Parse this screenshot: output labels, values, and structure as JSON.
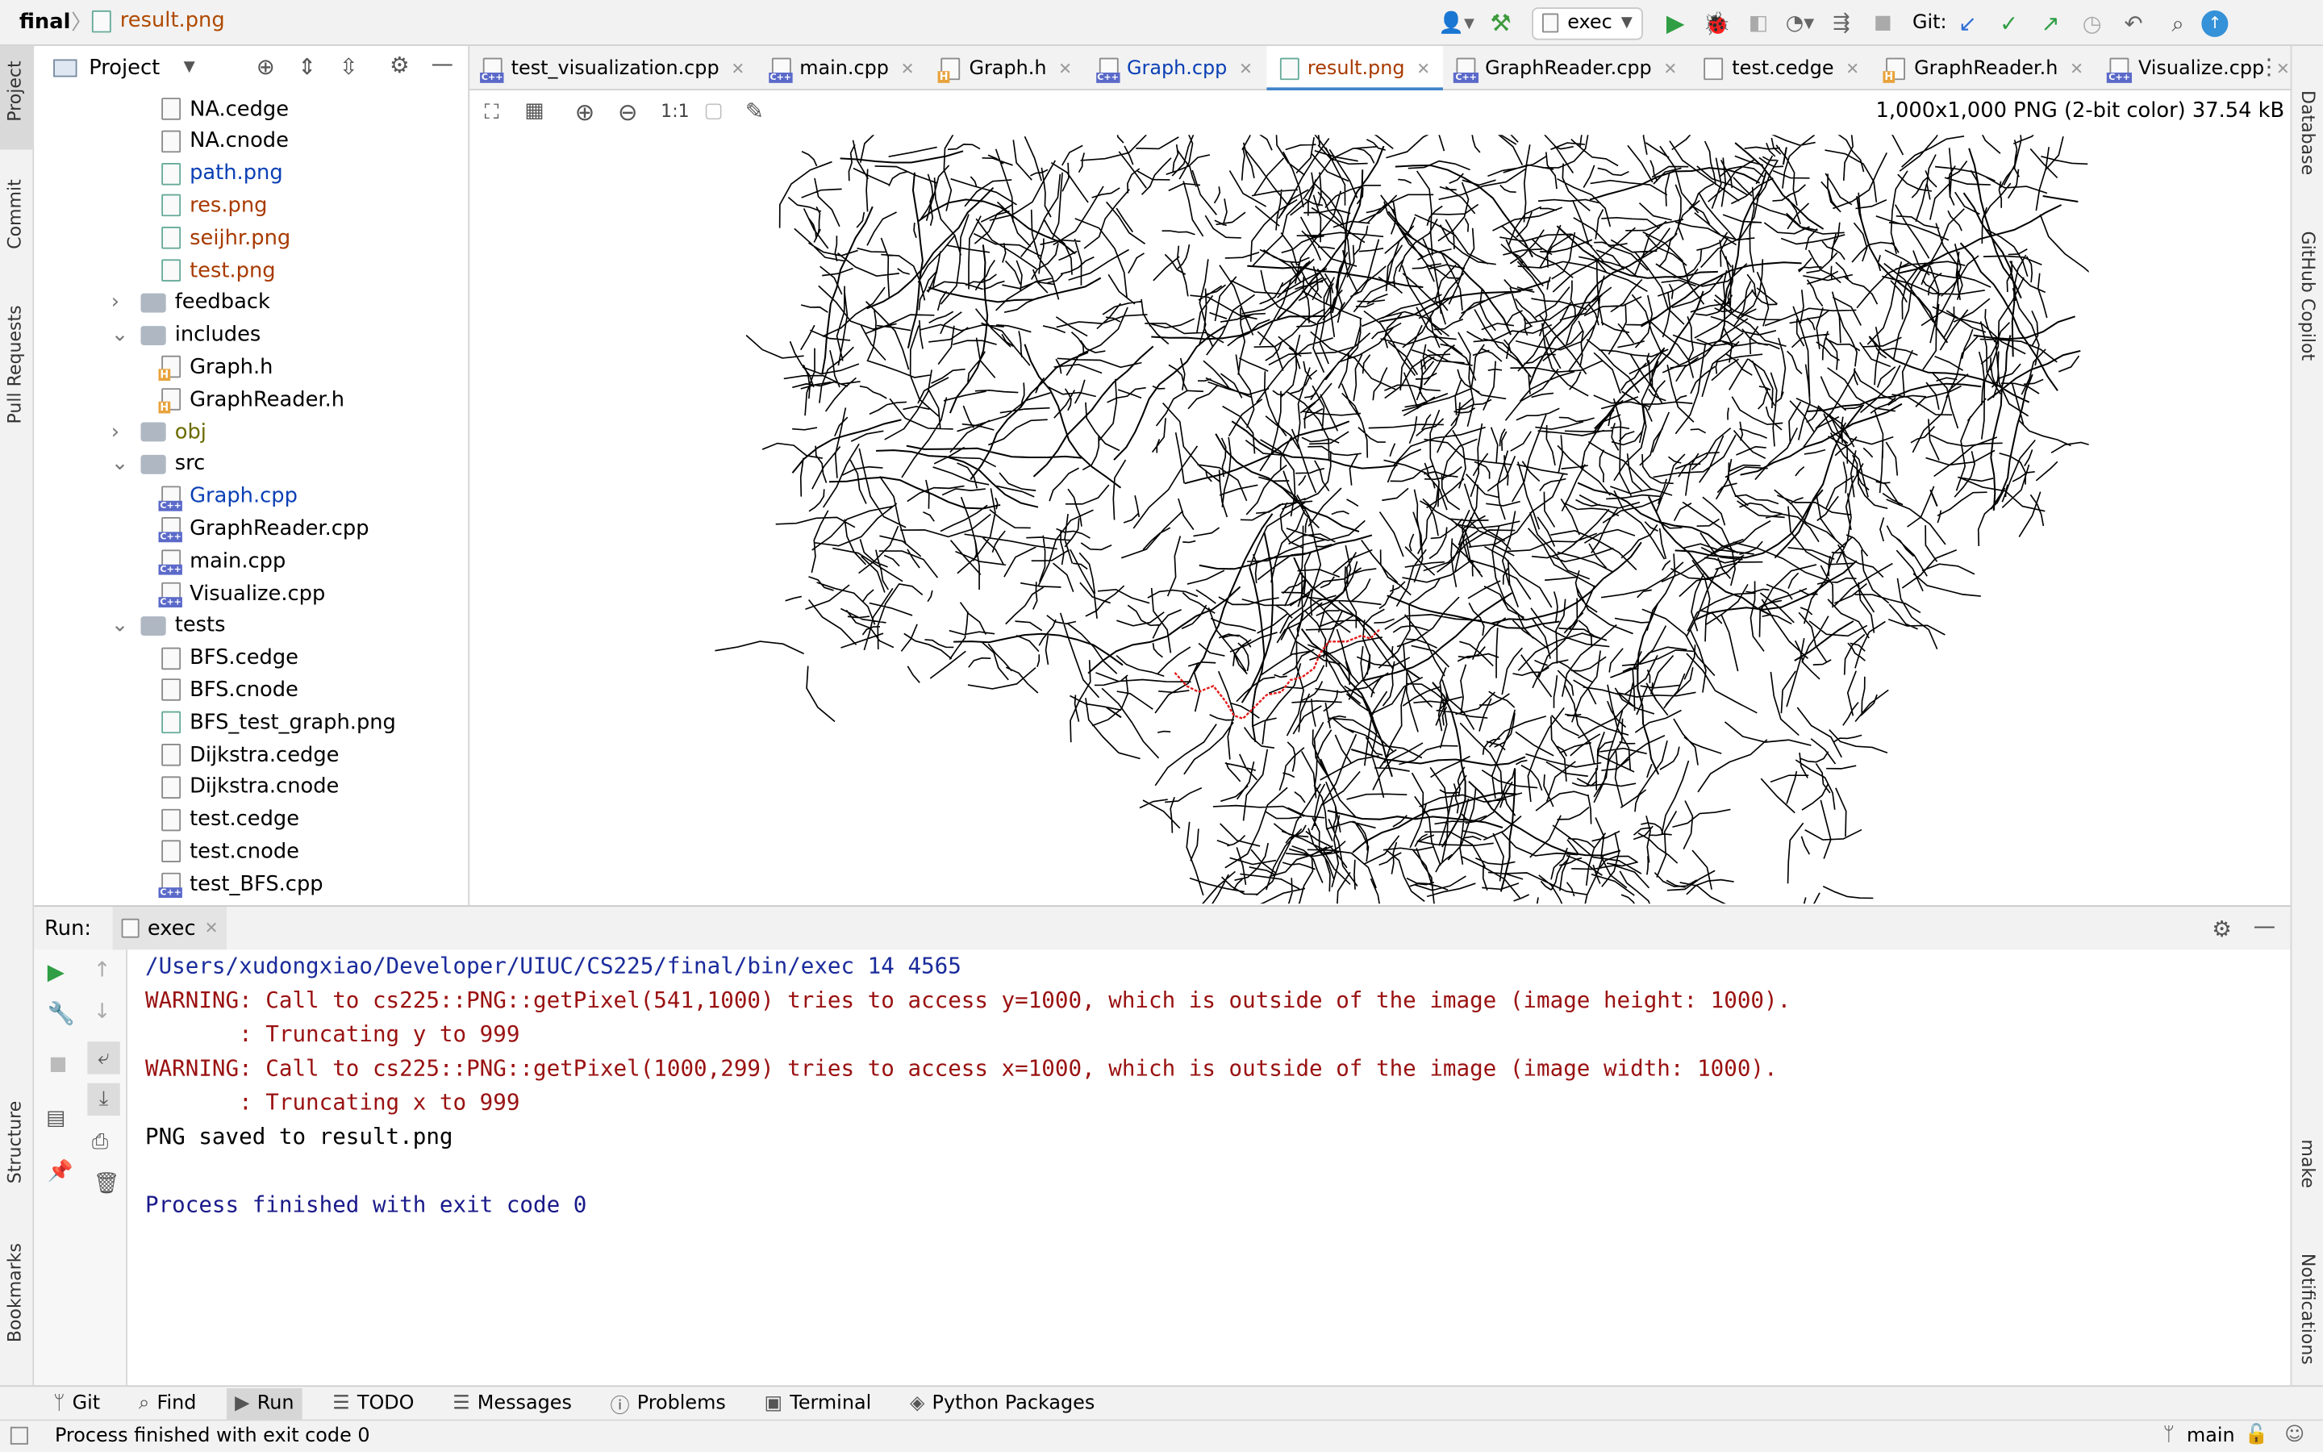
{
  "titlebar": {
    "project": "final",
    "file": "result.png",
    "run_config": "exec",
    "git_label": "Git:"
  },
  "left_strip": [
    "Project",
    "Commit",
    "Pull Requests",
    "Structure",
    "Bookmarks"
  ],
  "right_strip": [
    "Database",
    "GitHub Copilot",
    "make",
    "Notifications"
  ],
  "project_panel": {
    "title": "Project",
    "items": [
      {
        "label": "NA.cedge",
        "kind": "file",
        "color": "#000000"
      },
      {
        "label": "NA.cnode",
        "kind": "file",
        "color": "#000000"
      },
      {
        "label": "path.png",
        "kind": "png",
        "color": "#0a3fb5"
      },
      {
        "label": "res.png",
        "kind": "png",
        "color": "#a83a00"
      },
      {
        "label": "seijhr.png",
        "kind": "png",
        "color": "#a83a00"
      },
      {
        "label": "test.png",
        "kind": "png",
        "color": "#a83a00"
      },
      {
        "label": "feedback",
        "kind": "folder",
        "color": "#000000"
      },
      {
        "label": "includes",
        "kind": "folder",
        "color": "#000000"
      },
      {
        "label": "Graph.h",
        "kind": "h",
        "color": "#000000"
      },
      {
        "label": "GraphReader.h",
        "kind": "h",
        "color": "#000000"
      },
      {
        "label": "obj",
        "kind": "folder",
        "color": "#6b6b00"
      },
      {
        "label": "src",
        "kind": "folder",
        "color": "#000000"
      },
      {
        "label": "Graph.cpp",
        "kind": "cpp",
        "color": "#0a3fb5"
      },
      {
        "label": "GraphReader.cpp",
        "kind": "cpp",
        "color": "#000000"
      },
      {
        "label": "main.cpp",
        "kind": "cpp",
        "color": "#000000"
      },
      {
        "label": "Visualize.cpp",
        "kind": "cpp",
        "color": "#000000"
      },
      {
        "label": "tests",
        "kind": "folder",
        "color": "#000000"
      },
      {
        "label": "BFS.cedge",
        "kind": "file",
        "color": "#000000"
      },
      {
        "label": "BFS.cnode",
        "kind": "file",
        "color": "#000000"
      },
      {
        "label": "BFS_test_graph.png",
        "kind": "png",
        "color": "#000000"
      },
      {
        "label": "Dijkstra.cedge",
        "kind": "file",
        "color": "#000000"
      },
      {
        "label": "Dijkstra.cnode",
        "kind": "file",
        "color": "#000000"
      },
      {
        "label": "test.cedge",
        "kind": "file",
        "color": "#000000"
      },
      {
        "label": "test.cnode",
        "kind": "file",
        "color": "#000000"
      },
      {
        "label": "test_BFS.cpp",
        "kind": "cpp",
        "color": "#000000"
      }
    ]
  },
  "editor_tabs": [
    {
      "label": "test_visualization.cpp",
      "kind": "cpp",
      "color": "#000000"
    },
    {
      "label": "main.cpp",
      "kind": "cpp",
      "color": "#000000"
    },
    {
      "label": "Graph.h",
      "kind": "h",
      "color": "#000000"
    },
    {
      "label": "Graph.cpp",
      "kind": "cpp",
      "color": "#0a3fb5"
    },
    {
      "label": "result.png",
      "kind": "png",
      "color": "#a83a00",
      "active": true
    },
    {
      "label": "GraphReader.cpp",
      "kind": "cpp",
      "color": "#000000"
    },
    {
      "label": "test.cedge",
      "kind": "file",
      "color": "#000000"
    },
    {
      "label": "GraphReader.h",
      "kind": "h",
      "color": "#000000"
    },
    {
      "label": "Visualize.cpp",
      "kind": "cpp",
      "color": "#000000"
    }
  ],
  "image_viewer": {
    "info": "1,000x1,000 PNG (2-bit color) 37.54 kB",
    "zoom_label": "1:1"
  },
  "run": {
    "label": "Run:",
    "tab": "exec",
    "lines": [
      {
        "text": "/Users/xudongxiao/Developer/UIUC/CS225/final/bin/exec 14 4565",
        "style": "blue"
      },
      {
        "text": "WARNING: Call to cs225::PNG::getPixel(541,1000) tries to access y=1000, which is outside of the image (image height: 1000).",
        "style": "red"
      },
      {
        "text": "       : Truncating y to 999",
        "style": "red"
      },
      {
        "text": "WARNING: Call to cs225::PNG::getPixel(1000,299) tries to access x=1000, which is outside of the image (image width: 1000).",
        "style": "red"
      },
      {
        "text": "       : Truncating x to 999",
        "style": "red"
      },
      {
        "text": "PNG saved to result.png",
        "style": "plain"
      },
      {
        "text": "",
        "style": "plain"
      },
      {
        "text": "Process finished with exit code 0",
        "style": "navy"
      }
    ]
  },
  "bottom_tabs": [
    "Git",
    "Find",
    "Run",
    "TODO",
    "Messages",
    "Problems",
    "Terminal",
    "Python Packages"
  ],
  "status": {
    "message": "Process finished with exit code 0",
    "branch": "main"
  }
}
